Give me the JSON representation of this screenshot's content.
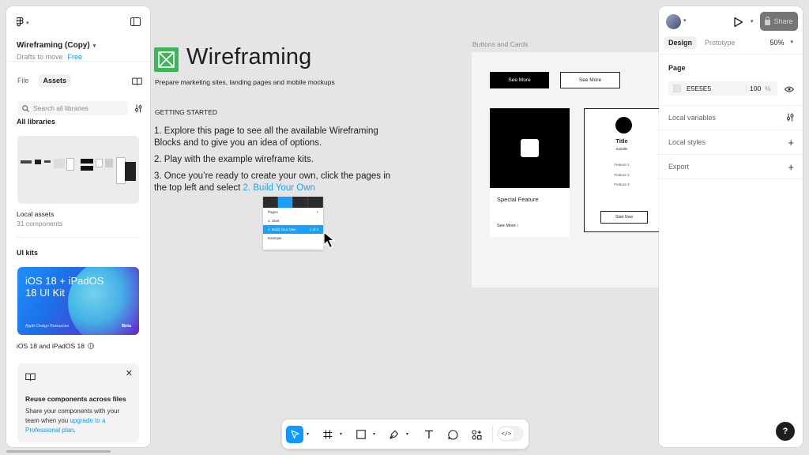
{
  "file": {
    "name": "Wireframing (Copy)",
    "location": "Drafts to move",
    "plan": "Free"
  },
  "left_panel": {
    "tabs": [
      "File",
      "Assets"
    ],
    "search_placeholder": "Search all libraries",
    "all_libraries_label": "All libraries",
    "local_assets": {
      "name": "Local assets",
      "count": "31 components"
    },
    "ui_kits_label": "UI kits",
    "kit": {
      "card_title": "iOS 18 + iPadOS 18 UI Kit",
      "card_footer": "Apple Design Resources",
      "card_badge": "Beta",
      "name": "iOS 18 and iPadOS 18"
    },
    "promo": {
      "title": "Reuse components across files",
      "body_prefix": "Share your components with your team when you ",
      "link": "upgrade to a Professional plan",
      "body_suffix": "."
    }
  },
  "canvas": {
    "title": "Wireframing",
    "subtitle": "Prepare marketing sites, landing pages and mobile mockups",
    "getting_started": "GETTING STARTED",
    "steps": [
      "1. Explore this page to see all the available Wireframing Blocks and to give you an idea of options.",
      "2. Play with the example wireframe kits.",
      "3. Once you’re ready to create your own, click the pages in the top left and select "
    ],
    "step3_link": "2. Build Your Own",
    "pages_mock": {
      "header": "Pages",
      "items": [
        "1. Start",
        "2. Build Your Own",
        "Example"
      ],
      "sel_meta": "1 of 3"
    },
    "frame_label": "Buttons and Cards",
    "frame": {
      "btn_primary": "See More",
      "btn_secondary": "See More",
      "card1_title": "Special Feature",
      "card1_link": "See More ›",
      "card2_title": "Title",
      "card2_subtitle": "Subtitle",
      "card2_features": [
        "Feature 1",
        "Feature 2",
        "Feature 3"
      ],
      "card2_button": "Start Now"
    }
  },
  "right_panel": {
    "share_label": "Share",
    "tabs": [
      "Design",
      "Prototype"
    ],
    "zoom": "50%",
    "page_section": "Page",
    "page_color": "E5E5E5",
    "page_opacity": "100",
    "page_opacity_unit": "%",
    "local_variables": "Local variables",
    "local_styles": "Local styles",
    "export": "Export",
    "help": "?"
  },
  "toolbar": {
    "tools": [
      "move-tool",
      "frame-tool",
      "shape-tool",
      "pen-tool",
      "text-tool",
      "comment-tool",
      "actions-tool"
    ],
    "dev_mode_label": "</>"
  },
  "colors": {
    "accent": "#0d99ff",
    "canvas": "#e5e5e5",
    "wireframe_icon": "#3fb55a"
  }
}
